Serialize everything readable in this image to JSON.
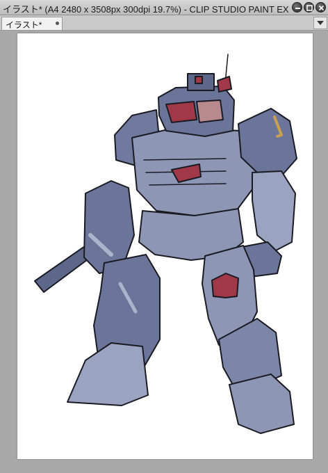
{
  "window": {
    "title": "イラスト* (A4 2480 x 3508px 300dpi 19.7%)  - CLIP STUDIO PAINT EX"
  },
  "controls": {
    "minimize_icon": "minimize-icon",
    "restore_icon": "restore-icon",
    "close_icon": "close-icon"
  },
  "tabs": [
    {
      "label": "イラスト*",
      "modified": true
    }
  ],
  "canvas": {
    "zoom": "19.7%",
    "artwork": "mecha-robot-illustration",
    "colors": {
      "armor": "#6a7599",
      "armor_light": "#aab4cc",
      "armor_dark": "#4f5a7e",
      "visor": "#a03848",
      "outline": "#1a1a22"
    }
  }
}
